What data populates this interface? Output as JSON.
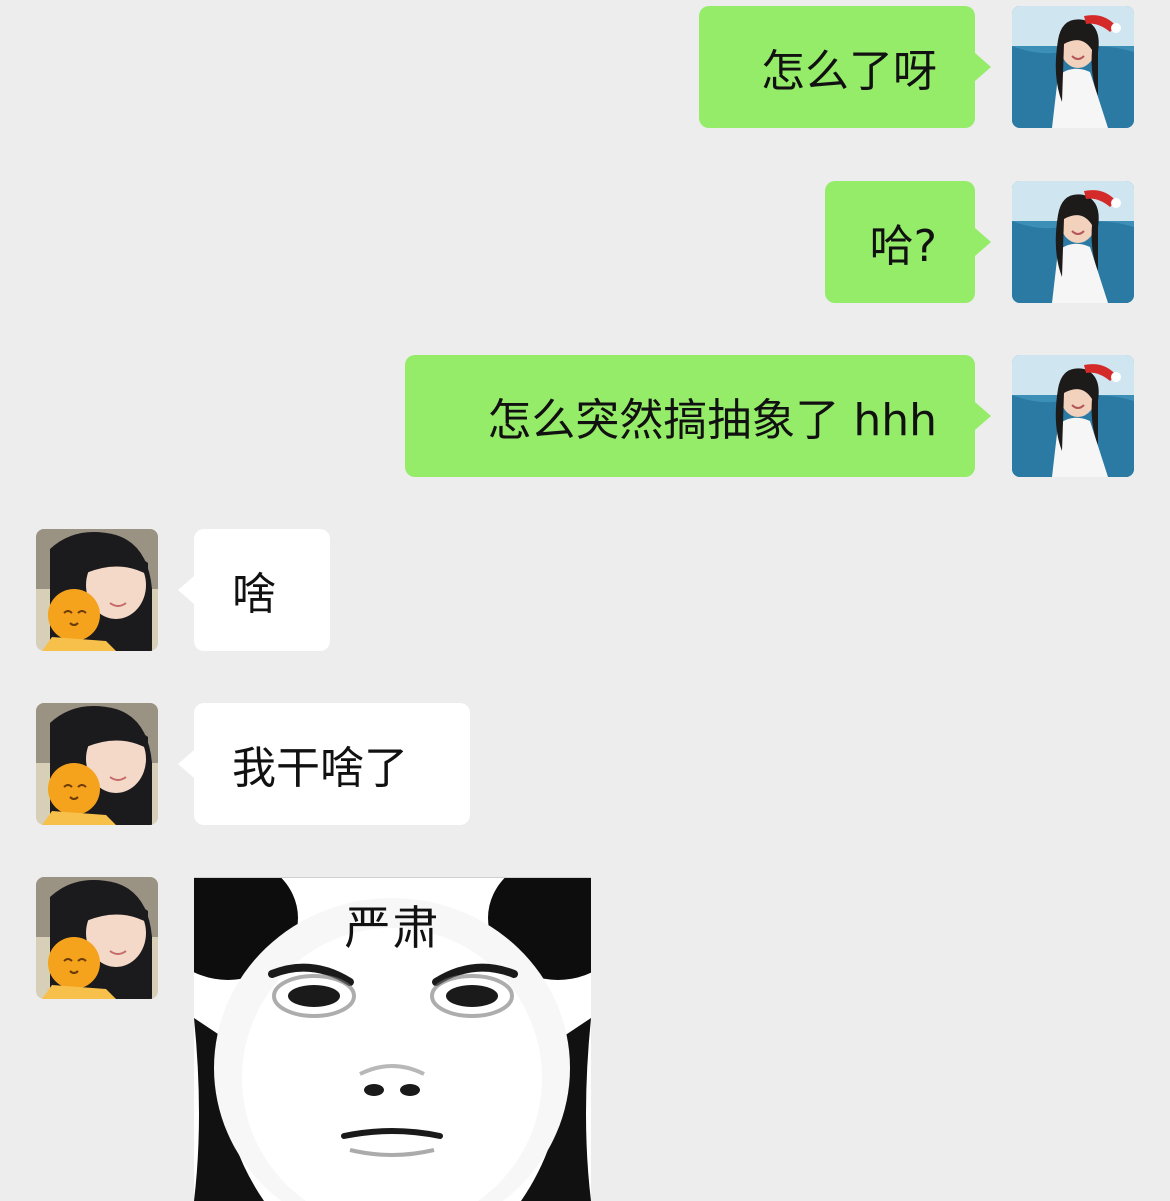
{
  "messages": [
    {
      "side": "sent",
      "text": "怎么了呀"
    },
    {
      "side": "sent",
      "text": "哈?"
    },
    {
      "side": "sent",
      "text": "怎么突然搞抽象了 hhh"
    },
    {
      "side": "received",
      "text": "啥"
    },
    {
      "side": "received",
      "text": "我干啥了"
    },
    {
      "side": "received",
      "type": "sticker",
      "caption": "严肃"
    }
  ],
  "colors": {
    "background": "#ededed",
    "sent_bubble": "#95ec69",
    "received_bubble": "#ffffff"
  }
}
